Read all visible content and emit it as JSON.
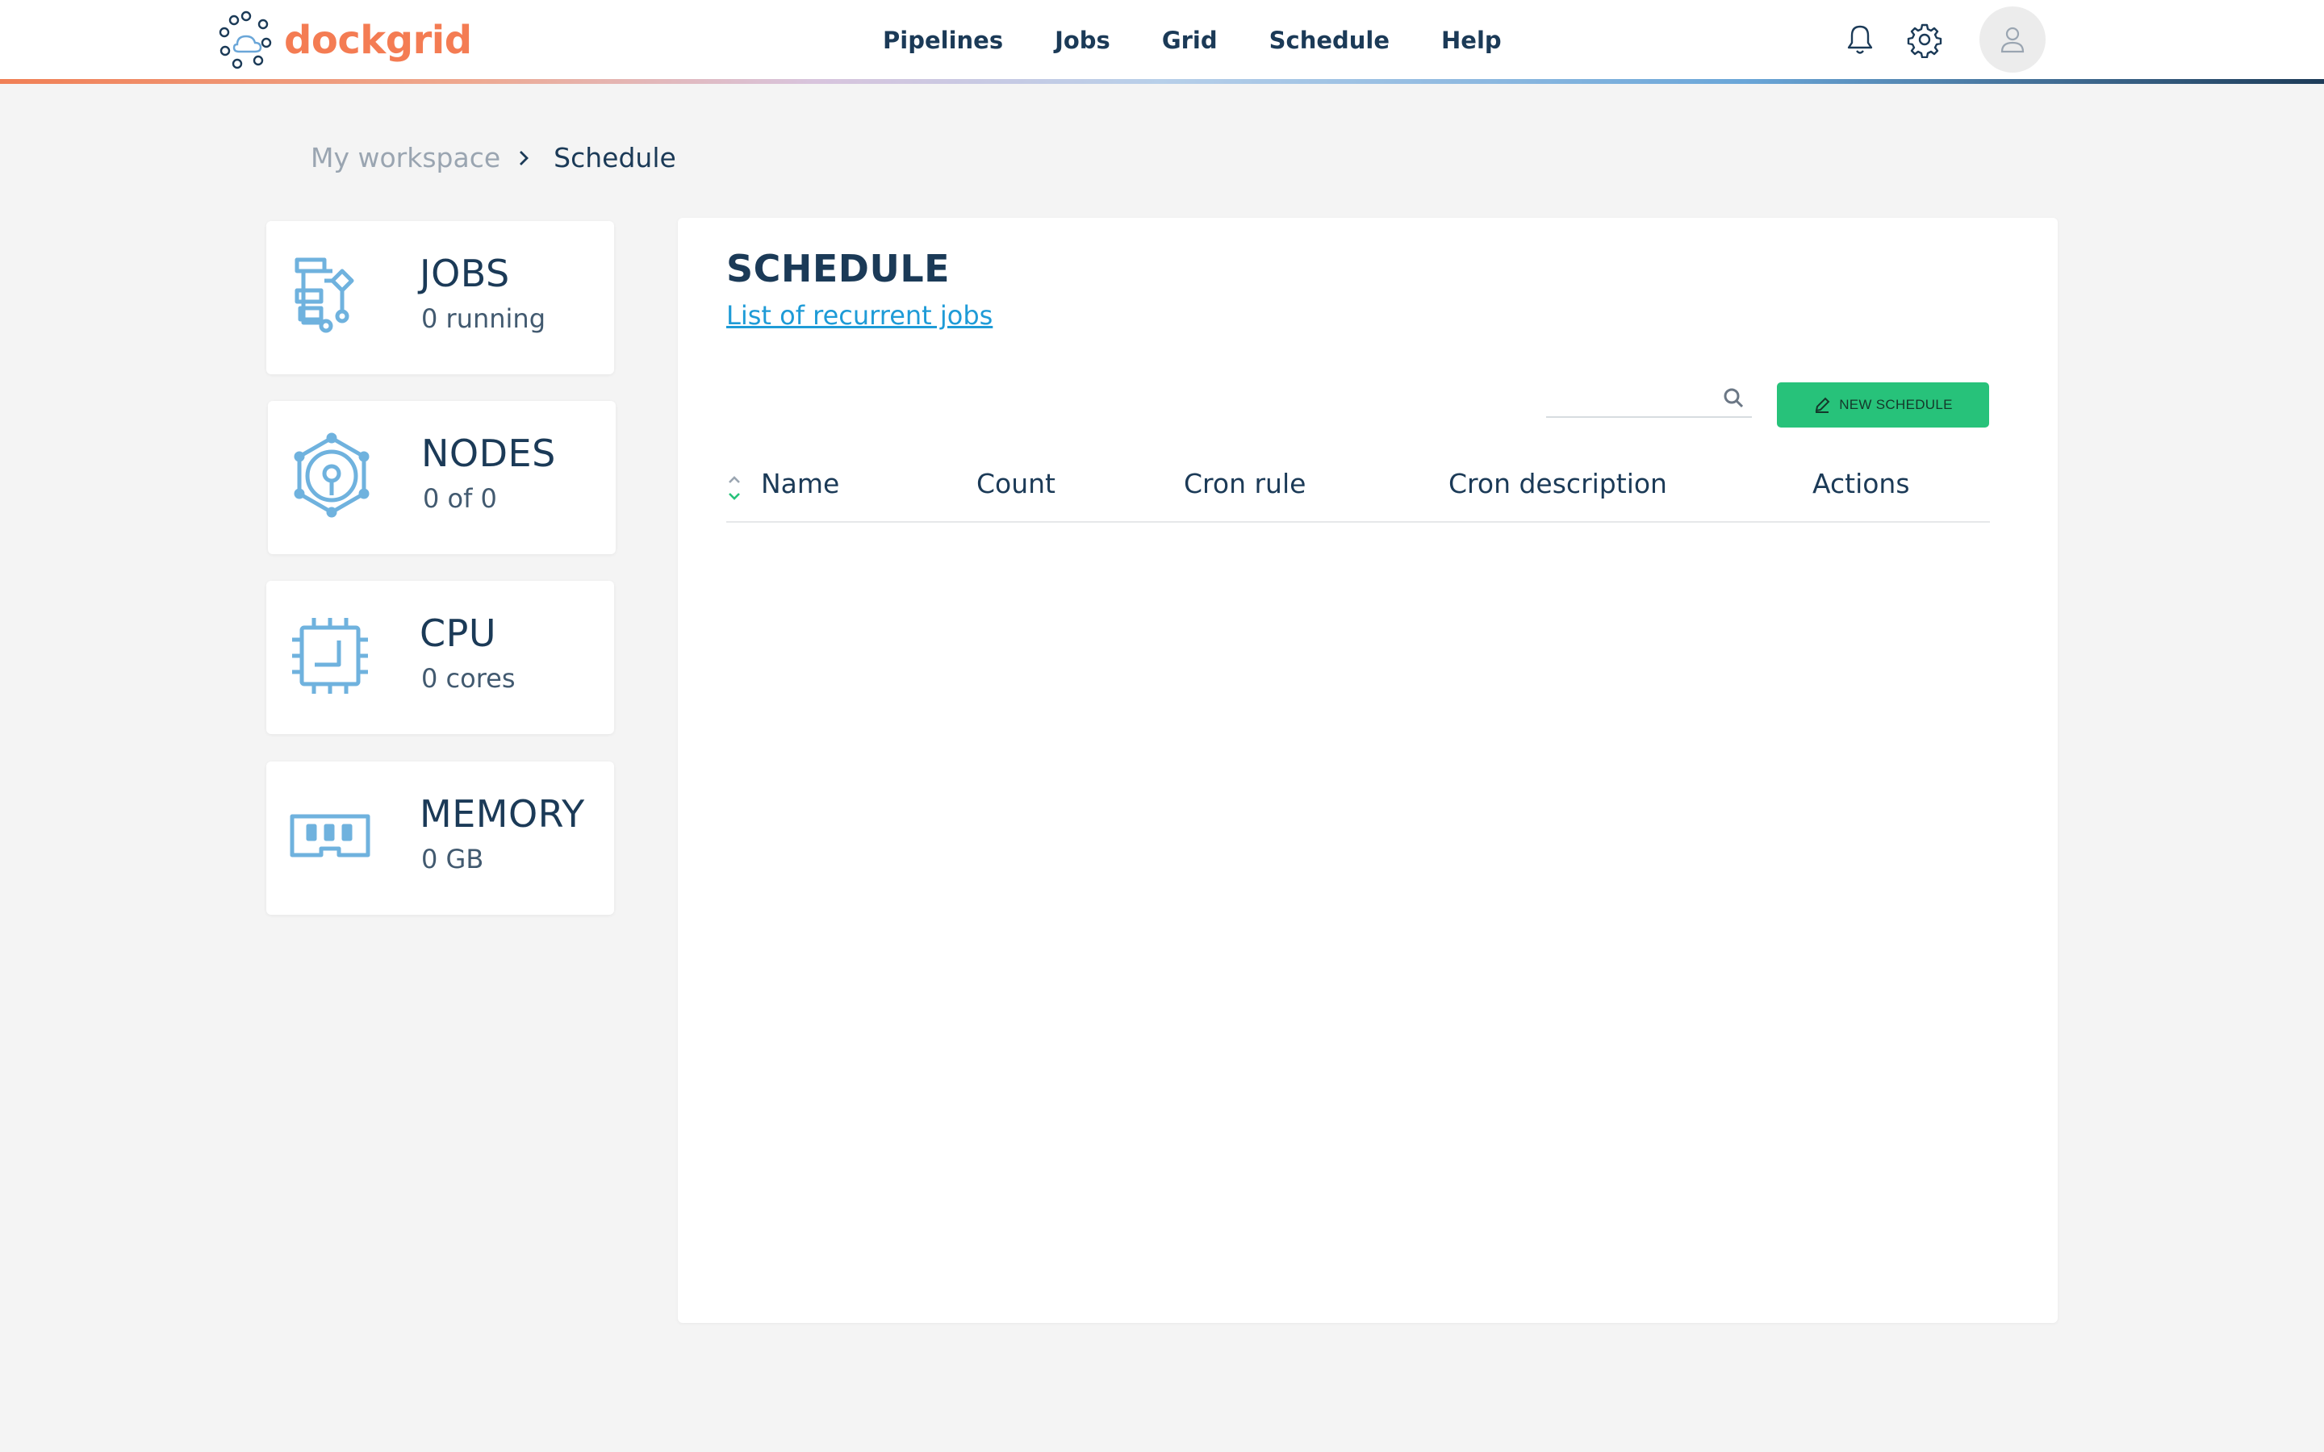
{
  "app": {
    "name": "dockgrid",
    "brand_color": "#f47c53",
    "accent_color": "#27c27a"
  },
  "nav": {
    "items": [
      "Pipelines",
      "Jobs",
      "Grid",
      "Schedule",
      "Help"
    ]
  },
  "header_icons": [
    "bell-icon",
    "gear-icon",
    "user-icon"
  ],
  "breadcrumb": {
    "root": "My workspace",
    "current": "Schedule"
  },
  "cards": [
    {
      "title": "JOBS",
      "subtitle": "0 running",
      "icon": "jobs-flow-icon"
    },
    {
      "title": "NODES",
      "subtitle": "0 of 0",
      "icon": "nodes-gear-icon"
    },
    {
      "title": "CPU",
      "subtitle": "0 cores",
      "icon": "cpu-chip-icon"
    },
    {
      "title": "MEMORY",
      "subtitle": "0 GB",
      "icon": "memory-module-icon"
    }
  ],
  "panel": {
    "title": "SCHEDULE",
    "subtitle_link": "List of recurrent jobs",
    "search": {
      "value": "",
      "placeholder": ""
    },
    "new_button": "NEW SCHEDULE",
    "columns": [
      "Name",
      "Count",
      "Cron rule",
      "Cron description",
      "Actions"
    ],
    "rows": []
  }
}
